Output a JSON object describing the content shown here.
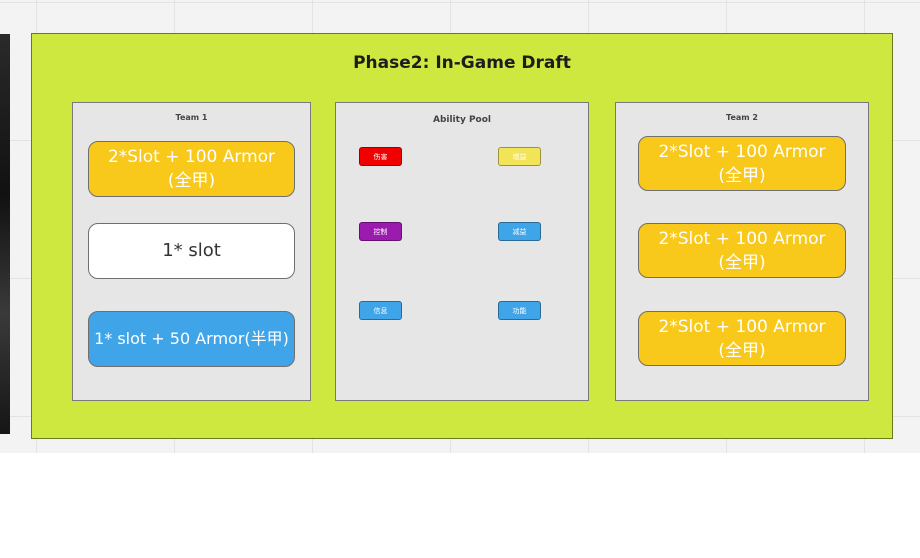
{
  "board": {
    "title": "Phase2: In-Game Draft",
    "colors": {
      "frame": "#cfe840",
      "panel": "#e6e6e6",
      "armor_full": "#f8c81b",
      "armor_half": "#3fa5e8",
      "slot_only": "#ffffff"
    }
  },
  "team1": {
    "title": "Team 1",
    "cards": [
      {
        "text": "2*Slot + 100 Armor\n(全甲)",
        "color": "yellow"
      },
      {
        "text": "1* slot",
        "color": "white"
      },
      {
        "text": "1* slot + 50 Armor(半甲)",
        "color": "blue"
      }
    ]
  },
  "ability_pool": {
    "title": "Ability Pool",
    "tags": [
      {
        "label": "伤害",
        "color": "#f00000"
      },
      {
        "label": "增益",
        "color": "#f2e458"
      },
      {
        "label": "控制",
        "color": "#9b1bae"
      },
      {
        "label": "减益",
        "color": "#3fa5e8"
      },
      {
        "label": "信息",
        "color": "#3fa5e8"
      },
      {
        "label": "功能",
        "color": "#3fa5e8"
      }
    ]
  },
  "team2": {
    "title": "Team 2",
    "cards": [
      {
        "text": "2*Slot + 100 Armor\n(全甲)",
        "color": "yellow"
      },
      {
        "text": "2*Slot + 100 Armor\n(全甲)",
        "color": "yellow"
      },
      {
        "text": "2*Slot + 100 Armor\n(全甲)",
        "color": "yellow"
      }
    ]
  }
}
